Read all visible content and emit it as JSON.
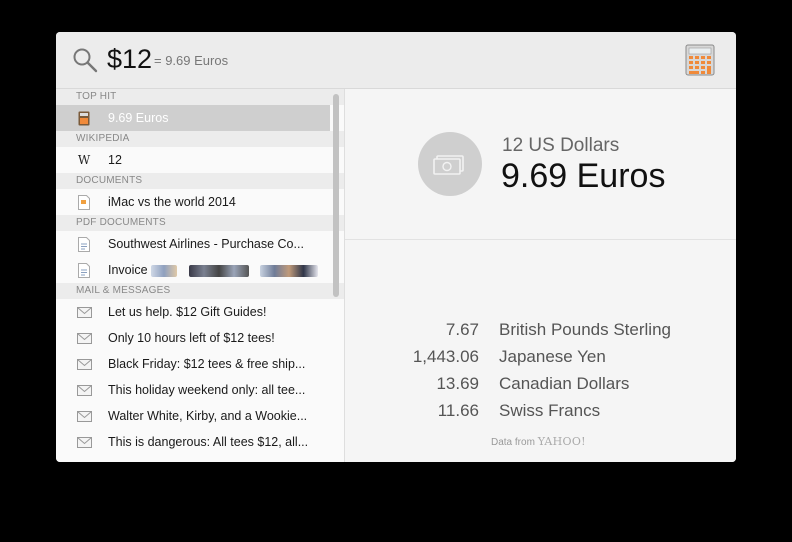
{
  "search": {
    "query": "$12",
    "inline_result": "= 9.69 Euros"
  },
  "results": {
    "sections": [
      {
        "header": "TOP HIT",
        "items": [
          {
            "label": "9.69 Euros",
            "icon": "calculator-icon",
            "selected": true
          }
        ]
      },
      {
        "header": "WIKIPEDIA",
        "items": [
          {
            "label": "12",
            "icon": "wikipedia-icon"
          }
        ]
      },
      {
        "header": "DOCUMENTS",
        "items": [
          {
            "label": "iMac vs the world 2014",
            "icon": "pages-document-icon"
          }
        ]
      },
      {
        "header": "PDF DOCUMENTS",
        "items": [
          {
            "label": "Southwest Airlines - Purchase Co...",
            "icon": "pdf-document-icon"
          },
          {
            "label": "Invoice",
            "icon": "pdf-document-icon",
            "redacted": true
          }
        ]
      },
      {
        "header": "MAIL & MESSAGES",
        "items": [
          {
            "label": "Let us help. $12 Gift Guides!",
            "icon": "mail-icon"
          },
          {
            "label": "Only 10 hours left of $12 tees!",
            "icon": "mail-icon"
          },
          {
            "label": "Black Friday: $12 tees & free ship...",
            "icon": "mail-icon"
          },
          {
            "label": "This holiday weekend only: all tee...",
            "icon": "mail-icon"
          },
          {
            "label": "Walter White, Kirby, and a Wookie...",
            "icon": "mail-icon"
          },
          {
            "label": "This is dangerous: All tees $12, all...",
            "icon": "mail-icon"
          }
        ]
      }
    ]
  },
  "detail": {
    "from_amount": "12 US Dollars",
    "to_amount": "9.69 Euros",
    "conversions": [
      {
        "value": "7.67",
        "currency": "British Pounds Sterling"
      },
      {
        "value": "1,443.06",
        "currency": "Japanese Yen"
      },
      {
        "value": "13.69",
        "currency": "Canadian Dollars"
      },
      {
        "value": "11.66",
        "currency": "Swiss Francs"
      }
    ],
    "data_from_label": "Data from",
    "data_source": "YAHOO!"
  }
}
